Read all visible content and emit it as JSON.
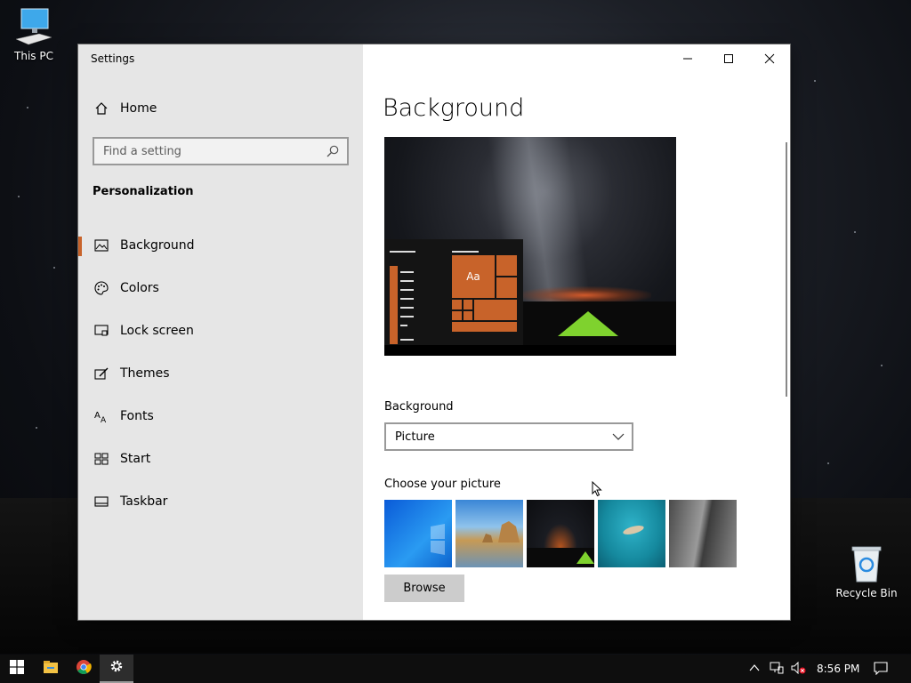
{
  "desktop": {
    "icons": [
      {
        "label": "This PC",
        "icon": "computer-icon"
      },
      {
        "label": "Recycle Bin",
        "icon": "recycle-bin-icon"
      }
    ]
  },
  "window": {
    "title": "Settings",
    "caption_buttons": [
      "minimize-icon",
      "maximize-icon",
      "close-icon"
    ]
  },
  "sidebar": {
    "home_label": "Home",
    "search_placeholder": "Find a setting",
    "section_title": "Personalization",
    "items": [
      {
        "label": "Background",
        "icon": "picture-icon",
        "active": true
      },
      {
        "label": "Colors",
        "icon": "palette-icon",
        "active": false
      },
      {
        "label": "Lock screen",
        "icon": "lock-screen-icon",
        "active": false
      },
      {
        "label": "Themes",
        "icon": "themes-icon",
        "active": false
      },
      {
        "label": "Fonts",
        "icon": "fonts-icon",
        "active": false
      },
      {
        "label": "Start",
        "icon": "start-icon",
        "active": false
      },
      {
        "label": "Taskbar",
        "icon": "taskbar-icon",
        "active": false
      }
    ]
  },
  "main": {
    "page_title": "Background",
    "preview_tile_text": "Aa",
    "background_label": "Background",
    "background_selected": "Picture",
    "choose_picture_label": "Choose your picture",
    "thumbnails": [
      "windows-blue",
      "beach-rocks",
      "night-sky-tent",
      "underwater-swimmer",
      "rock-cliff"
    ],
    "browse_label": "Browse"
  },
  "taskbar": {
    "apps": [
      "start-icon",
      "file-explorer-icon",
      "chrome-icon",
      "settings-icon"
    ],
    "active_app": "settings-icon",
    "clock": "8:56 PM"
  },
  "colors": {
    "accent": "#c8632a",
    "sidebar_bg": "#e6e6e6",
    "taskbar_bg": "#0e0e0e"
  }
}
